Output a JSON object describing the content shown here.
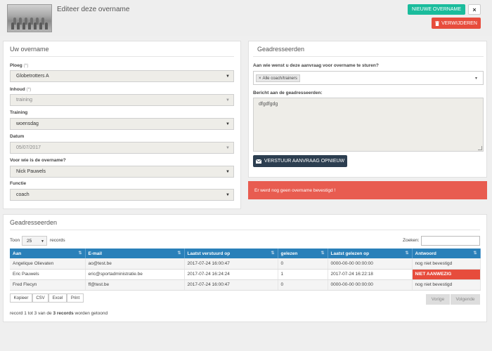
{
  "header": {
    "title": "Editeer deze overname",
    "new_button": "Nieuwe overname",
    "close_button": "×",
    "delete_button": "Verwijderen",
    "delete_icon": "trash-icon"
  },
  "form": {
    "title": "Uw overname",
    "ploeg": {
      "label": "Ploeg",
      "required": "(*)",
      "value": "Globetrotters A"
    },
    "inhoud": {
      "label": "Inhoud",
      "required": "(*)",
      "value": "training"
    },
    "training": {
      "label": "Training",
      "value": "woensdag"
    },
    "datum": {
      "label": "Datum",
      "value": "05/07/2017"
    },
    "voor_wie": {
      "label": "Voor wie is de overname?",
      "value": "Nick Pauwels"
    },
    "functie": {
      "label": "Functie",
      "value": "coach"
    }
  },
  "recipients_panel": {
    "title": "Geadresseerden",
    "question": "Aan wie wenst u deze aanvraag voor overname te sturen?",
    "tag": "Alle coach/trainers",
    "tag_remove": "×",
    "message_label": "Bericht aan de geadresseerden:",
    "message_value": "dfgdfgdg",
    "send_button": "Verstuur aanvraag opnieuw",
    "send_icon": "envelope-icon"
  },
  "alert": {
    "text": "Er werd nog geen overname bevestigd !",
    "color": "#e85c50"
  },
  "table_panel": {
    "title": "Geadresseerden",
    "length_prefix": "Toon",
    "length_value": "25",
    "length_suffix": "records",
    "search_label": "Zoeken:",
    "search_value": "",
    "columns": [
      "Aan",
      "E-mail",
      "Laatst verstuurd op",
      "gelezen",
      "Laatst gelezen op",
      "Antwoord"
    ],
    "rows": [
      {
        "aan": "Angelique Olievaten",
        "email": "ao@test.be",
        "verstuurd": "2017-07-24 16:00:47",
        "gelezen": "0",
        "gelezen_op": "0000-00-00 00:00:00",
        "antwoord": "nog niet bevestigd",
        "status": "normal"
      },
      {
        "aan": "Eric Pauwels",
        "email": "eric@sportadministratie.be",
        "verstuurd": "2017-07-24 16:24:24",
        "gelezen": "1",
        "gelezen_op": "2017-07-24 16:22:18",
        "antwoord": "NIET AANWEZIG",
        "status": "danger"
      },
      {
        "aan": "Fred Flecyn",
        "email": "ff@test.be",
        "verstuurd": "2017-07-24 16:00:47",
        "gelezen": "0",
        "gelezen_op": "0000-00-00 00:00:00",
        "antwoord": "nog niet bevestigd",
        "status": "normal"
      }
    ],
    "export_buttons": [
      "Kopieer",
      "CSV",
      "Excel",
      "Print"
    ],
    "prev": "Vorige",
    "next": "Volgende",
    "info_prefix": "record 1 tot 3 van de",
    "info_bold": "3 records",
    "info_suffix": "worden getoond"
  },
  "colors": {
    "accent": "#1abc9c",
    "danger": "#e74c3c",
    "table_header": "#2a80b9",
    "dark_button": "#2c3e50"
  }
}
